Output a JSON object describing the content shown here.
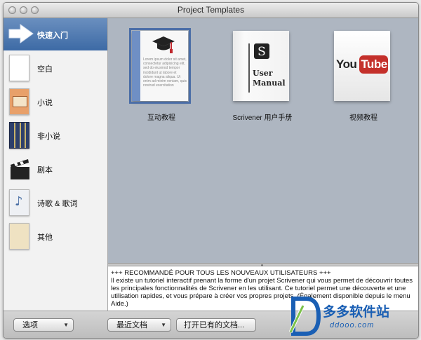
{
  "window": {
    "title": "Project Templates"
  },
  "sidebar": {
    "items": [
      {
        "label": "快速入门",
        "selected": true
      },
      {
        "label": "空白"
      },
      {
        "label": "小说"
      },
      {
        "label": "非小说"
      },
      {
        "label": "剧本"
      },
      {
        "label": "诗歌 & 歌词"
      },
      {
        "label": "其他"
      }
    ]
  },
  "templates": [
    {
      "label": "互动教程",
      "selected": true,
      "thumb_text": "Lorem ipsum dolor sit amet, consectetur adipisicing elit, sed do eiusmod tempor incididunt ut labore et dolore magna aliqua. Ut enim ad minim veniam, quis nostrud exercitation"
    },
    {
      "label": "Scrivener 用户手册",
      "thumb_text_1": "User",
      "thumb_text_2": "Manual"
    },
    {
      "label": "视频教程",
      "thumb_you": "You",
      "thumb_tube": "Tube"
    }
  ],
  "description": {
    "heading": "+++ RECOMMANDÉ POUR TOUS LES NOUVEAUX UTILISATEURS +++",
    "body": "Il existe un tutoriel interactif prenant la forme d'un projet Scrivener qui vous permet de découvrir toutes les principales fonctionnalités de Scrivener en les utilisant. Ce tutoriel permet une découverte et une utilisation rapides, et vous prépare à créer vos propres projets. (Également disponible depuis le menu Aide.)"
  },
  "toolbar": {
    "options_label": "选项",
    "recent_label": "最近文档",
    "open_label": "打开已有的文档..."
  },
  "watermark": {
    "brand": "多多软件站",
    "url": "ddooo.com"
  },
  "colors": {
    "selection": "#3d6aa5",
    "grid_bg": "#aeb6c1",
    "youtube_red": "#c4302b",
    "watermark_blue": "#1a5fb4"
  }
}
